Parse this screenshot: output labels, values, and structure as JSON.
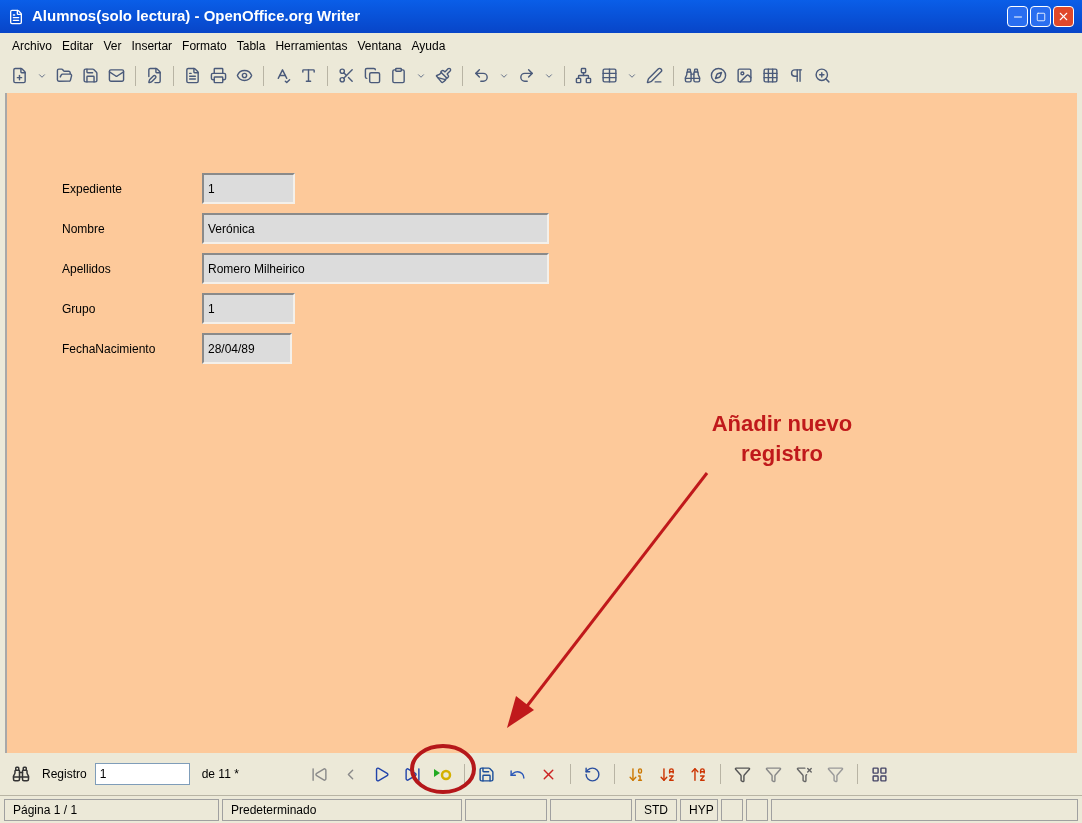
{
  "window": {
    "title": "Alumnos(solo lectura) - OpenOffice.org Writer"
  },
  "menu": [
    "Archivo",
    "Editar",
    "Ver",
    "Insertar",
    "Formato",
    "Tabla",
    "Herramientas",
    "Ventana",
    "Ayuda"
  ],
  "form": [
    {
      "label": "Expediente",
      "value": "1",
      "kind": "short"
    },
    {
      "label": "Nombre",
      "value": "Verónica",
      "kind": "long"
    },
    {
      "label": "Apellidos",
      "value": "Romero Milheirico",
      "kind": "long"
    },
    {
      "label": "Grupo",
      "value": "1",
      "kind": "short"
    },
    {
      "label": "FechaNacimiento",
      "value": "28/04/89",
      "kind": "date"
    }
  ],
  "annotation": {
    "text": "Añadir nuevo registro"
  },
  "navigation": {
    "label": "Registro",
    "value": "1",
    "total": "de 11 *"
  },
  "status_bar": [
    {
      "kind": "text",
      "text": "Página 1 / 1"
    },
    {
      "kind": "text",
      "text": "Predeterminado"
    },
    {
      "kind": "empty"
    },
    {
      "kind": "empty"
    },
    {
      "kind": "text",
      "text": "STD"
    },
    {
      "kind": "text",
      "text": "HYP"
    },
    {
      "kind": "empty"
    },
    {
      "kind": "empty"
    },
    {
      "kind": "empty"
    }
  ]
}
